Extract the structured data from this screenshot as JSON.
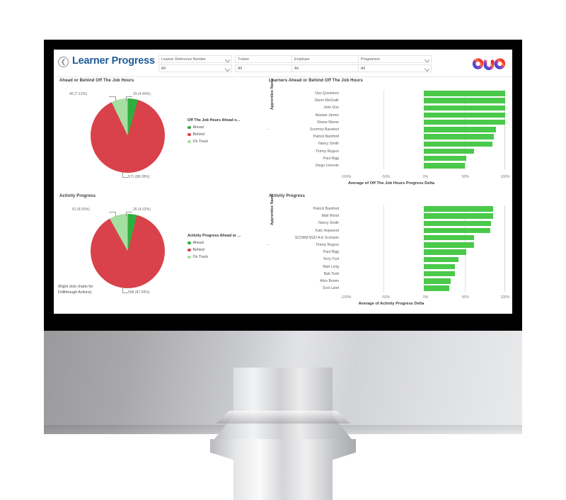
{
  "header": {
    "back_icon": "back-arrow-circle-icon",
    "title": "Learner Progress",
    "logo_text": "bud",
    "filters": [
      {
        "label": "Learner Reference Number",
        "value": "All"
      },
      {
        "label": "Trainer",
        "value": "All"
      },
      {
        "label": "Employer",
        "value": "All"
      },
      {
        "label": "Programme",
        "value": "All"
      }
    ]
  },
  "colors": {
    "title_blue": "#1f5c99",
    "ahead_green": "#2fae3e",
    "behind_red": "#d9424a",
    "on_track_light_green": "#a5e0a0",
    "bar_green": "#4ac94a"
  },
  "drill_note": "(Right click charts for\nDrillthrough Actions)",
  "chart_data": [
    {
      "id": "off-the-job-hours-pie",
      "type": "pie",
      "title": "Ahead or Behind Off The Job Hours",
      "legend_title": "Off The Job Hours Ahead o...",
      "legend_position": "right",
      "categories": [
        "Ahead",
        "Behind",
        "On Track"
      ],
      "values": [
        29,
        571,
        46
      ],
      "percentages": [
        "4.49%",
        "88.39%",
        "7.12%"
      ],
      "labels": [
        "29 (4.49%)",
        "571 (88.39%)",
        "46 (7.12%)"
      ],
      "colors": [
        "#2fae3e",
        "#d9424a",
        "#a5e0a0"
      ]
    },
    {
      "id": "learners-ahead-behind-off-the-job-hours-bar",
      "type": "bar",
      "orientation": "horizontal",
      "title": "Learners Ahead or Behind Off The Job Hours",
      "ylabel": "Apprentice Name",
      "xlabel": "Average of Off The Job Hours Progress Delta",
      "xticks": [
        "-100%",
        "-50%",
        "0%",
        "50%",
        "100%"
      ],
      "xlim": [
        -100,
        100
      ],
      "grid": true,
      "categories": [
        "Ops Questions",
        "Glenn McGrath",
        "John Doe",
        "Alastair James",
        "Shane Warne",
        "Scormzy Basetest",
        "Patrick Bamford",
        "Nancy Smith",
        "Timmy Rogers",
        "Paul Rigg",
        "Diego Llorente"
      ],
      "values": [
        100,
        100,
        100,
        100,
        100,
        89,
        86,
        84,
        62,
        52,
        50
      ],
      "color": "#4ac94a"
    },
    {
      "id": "activity-progress-pie",
      "type": "pie",
      "title": "Activity Progress",
      "legend_title": "Activity Progress Ahead or ...",
      "legend_position": "right",
      "categories": [
        "Ahead",
        "Behind",
        "On Track"
      ],
      "values": [
        26,
        568,
        52
      ],
      "percentages": [
        "4.02%",
        "87.93%",
        "8.05%"
      ],
      "labels": [
        "26 (4.02%)",
        "568 (87.93%)",
        "52 (8.05%)"
      ],
      "colors": [
        "#2fae3e",
        "#d9424a",
        "#a5e0a0"
      ]
    },
    {
      "id": "activity-progress-bar",
      "type": "bar",
      "orientation": "horizontal",
      "title": "Activity Progress",
      "ylabel": "Apprentice Name",
      "xlabel": "Average of Activity Progress Delta",
      "xticks": [
        "-100%",
        "-50%",
        "0%",
        "50%",
        "100%"
      ],
      "xlim": [
        -100,
        100
      ],
      "grid": true,
      "categories": [
        "Patrick Bamford",
        "Matt Wood",
        "Nancy Smith",
        "Katy Hopwood",
        "SCORM BUD A-E Scenario",
        "Timmy Rogers",
        "Paul Rigg",
        "Terry Tryit",
        "Matt Long",
        "Bab Testt",
        "Alice Brown",
        "Scot Land"
      ],
      "values": [
        85,
        85,
        83,
        82,
        62,
        62,
        52,
        43,
        38,
        38,
        33,
        31
      ],
      "color": "#4ac94a"
    }
  ]
}
